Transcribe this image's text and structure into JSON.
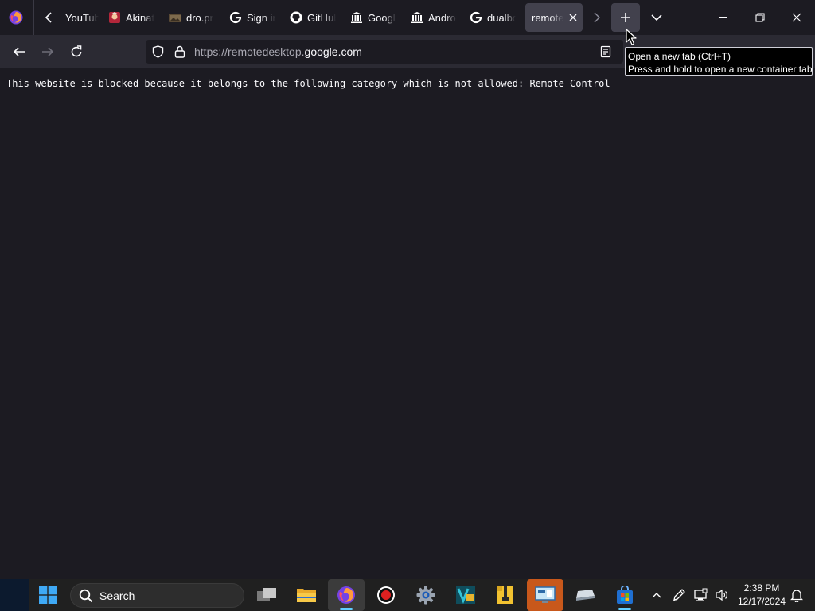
{
  "browser": {
    "tabs": [
      {
        "title": "YouTube",
        "favicon": "youtube-icon"
      },
      {
        "title": "Akinator",
        "favicon": "akinator-icon"
      },
      {
        "title": "dro.pro",
        "favicon": "folder-image-icon"
      },
      {
        "title": "Sign in",
        "favicon": "google-icon"
      },
      {
        "title": "GitHub",
        "favicon": "github-icon"
      },
      {
        "title": "Google",
        "favicon": "library-icon"
      },
      {
        "title": "Android",
        "favicon": "library-icon"
      },
      {
        "title": "dualboot",
        "favicon": "google-icon"
      },
      {
        "title": "remotedesktop",
        "favicon": "none",
        "active": true
      }
    ],
    "url": {
      "prefix": "https://remotedesktop.",
      "host": "google.com"
    },
    "tooltip": {
      "line1": "Open a new tab (Ctrl+T)",
      "line2": "Press and hold to open a new container tab"
    }
  },
  "page": {
    "message": "This website is blocked because it belongs to the following category which is not allowed: Remote Control"
  },
  "taskbar": {
    "search_label": "Search",
    "time": "2:38 PM",
    "date": "12/17/2024"
  },
  "colors": {
    "toolbar": "#2b2a33",
    "tabstrip": "#1c1b22",
    "active_tab": "#42414d",
    "accent": "#60cdff"
  }
}
